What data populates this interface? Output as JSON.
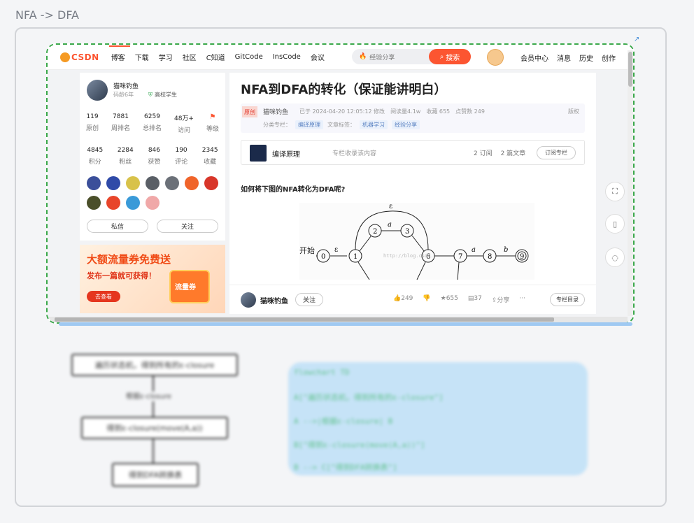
{
  "page_title": "NFA -> DFA",
  "nav": {
    "logo": "CSDN",
    "items": [
      "博客",
      "下载",
      "学习",
      "社区",
      "C知道",
      "GitCode",
      "InsCode",
      "会议"
    ],
    "search_placeholder": "经验分享",
    "search_button": "搜索",
    "right_items": [
      "会员中心",
      "消息",
      "历史",
      "创作"
    ]
  },
  "profile": {
    "name": "猫咪钓鱼",
    "code_age": "码龄6年",
    "school": "高校学生",
    "stats1": [
      {
        "value": "119",
        "label": "原创"
      },
      {
        "value": "7881",
        "label": "周排名"
      },
      {
        "value": "6259",
        "label": "总排名"
      },
      {
        "value": "48万+",
        "label": "访问"
      },
      {
        "value": "",
        "label": "等级"
      }
    ],
    "stats2": [
      {
        "value": "4845",
        "label": "积分"
      },
      {
        "value": "2284",
        "label": "粉丝"
      },
      {
        "value": "846",
        "label": "获赞"
      },
      {
        "value": "190",
        "label": "评论"
      },
      {
        "value": "2345",
        "label": "收藏"
      }
    ],
    "message_btn": "私信",
    "follow_btn": "关注"
  },
  "ad": {
    "title": "大额流量券免费送",
    "subtitle": "发布一篇就可获得！",
    "button": "去查看",
    "coupon": "流量券"
  },
  "article": {
    "title": "NFA到DFA的转化（保证能讲明白）",
    "original_tag": "原创",
    "author": "猫咪钓鱼",
    "date": "已于 2024-04-20 12:05:12 修改",
    "reads": "阅读量4.1w",
    "favorites": "收藏 655",
    "likes": "点赞数 249",
    "copyright": "版权",
    "category_label": "分类专栏：",
    "category": "编译原理",
    "tags_label": "文章标签：",
    "tags": [
      "机器学习",
      "经验分享"
    ],
    "column_name": "编译原理",
    "column_desc": "专栏收录该内容",
    "column_subs": "2 订阅",
    "column_articles": "2 篇文章",
    "column_subscribe": "订阅专栏",
    "question": "如何将下图的NFA转化为DFA呢?"
  },
  "diagram": {
    "start_label": "开始",
    "epsilon": "ε",
    "watermark": "http://blog.csdn.",
    "states": [
      "0",
      "1",
      "2",
      "3",
      "6",
      "7",
      "8",
      "9"
    ],
    "edge_labels": [
      "a",
      "a",
      "b"
    ]
  },
  "bottom_bar": {
    "author": "猫咪钓鱼",
    "follow": "关注",
    "likes": "249",
    "favorites": "655",
    "comments": "37",
    "share": "分享",
    "more": "···",
    "column_toc": "专栏目录"
  },
  "flowchart": {
    "node1": "遍历状态机，得到所有的ε-closure",
    "edge_label": "根据ε-closure",
    "node2": "得到ε-closure(move(A,a))",
    "node3": "得到DFA转换表"
  },
  "code": {
    "lines": [
      "flowchart TD",
      "A[\"遍历状态机，得到所有的ε-closure\"]",
      "A -->|根据ε-closure| B",
      "B[\"得到ε-closure(move(A,a))\"]",
      "B --> C[\"得到DFA转换表\"]"
    ]
  }
}
